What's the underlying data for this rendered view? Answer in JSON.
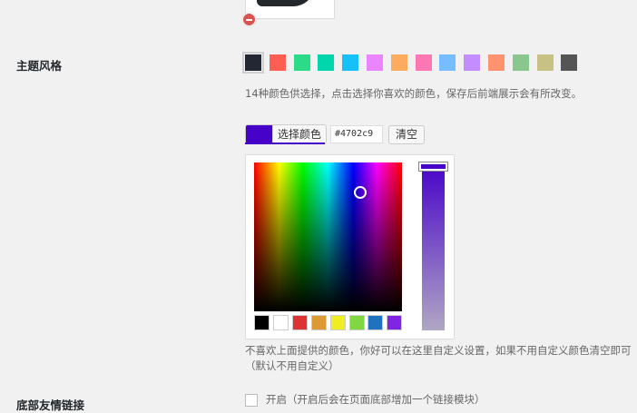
{
  "theme_style": {
    "label": "主题风格",
    "description": "14种颜色供选择，点击选择你喜欢的颜色，保存后前端展示会有所改变。",
    "swatches": [
      {
        "color": "#222733",
        "selected": true
      },
      {
        "color": "#ff5e52"
      },
      {
        "color": "#2cdb87"
      },
      {
        "color": "#00d6ac"
      },
      {
        "color": "#16c0f8"
      },
      {
        "color": "#ea84ff"
      },
      {
        "color": "#fdac5f"
      },
      {
        "color": "#fd77b2"
      },
      {
        "color": "#76bdff"
      },
      {
        "color": "#c38cff"
      },
      {
        "color": "#ff926f"
      },
      {
        "color": "#8ac78f"
      },
      {
        "color": "#c7c183"
      },
      {
        "color": "#555555"
      }
    ]
  },
  "color_picker": {
    "current_color": "#4702c9",
    "button_label": "选择颜色",
    "hex_value": "#4702c9",
    "clear_label": "清空",
    "palette": [
      "#000000",
      "#ffffff",
      "#dd3333",
      "#dd9933",
      "#eeee22",
      "#81d742",
      "#1e73be",
      "#8224e3"
    ],
    "description": "不喜欢上面提供的颜色，你好可以在这里自定义设置，如果不用自定义颜色清空即可（默认不用自定义）"
  },
  "footer_links": {
    "label": "底部友情链接",
    "checkbox_label": "开启（开启后会在页面底部增加一个链接模块）"
  }
}
